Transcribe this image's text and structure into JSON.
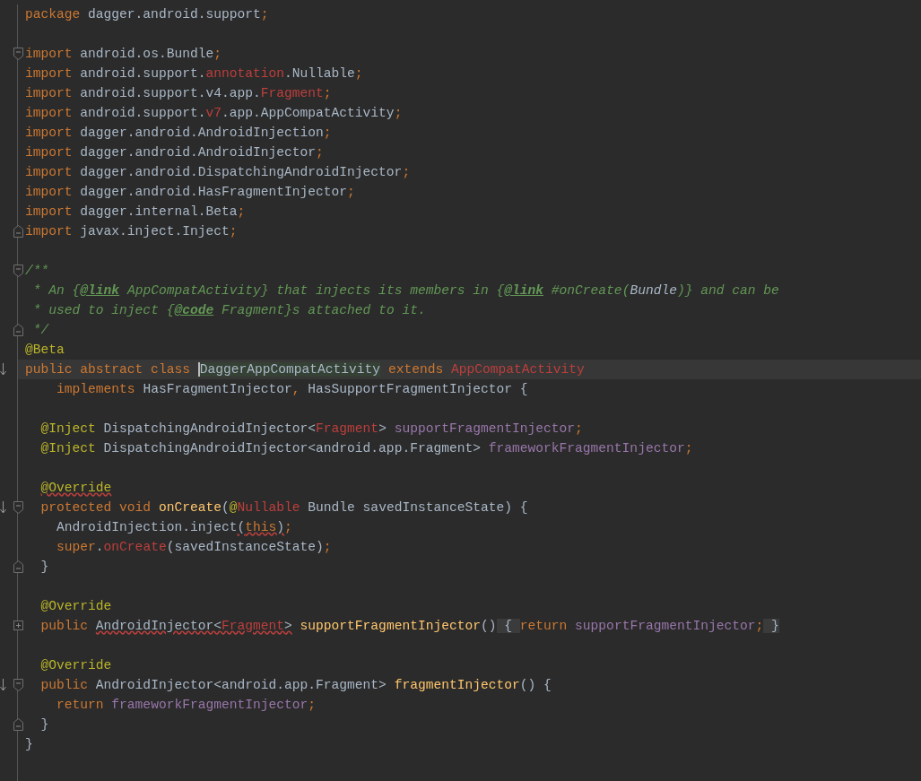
{
  "editor": {
    "lines": [
      {
        "kind": "code",
        "current": false,
        "tokens": [
          {
            "text": "package ",
            "kind": "kw"
          },
          {
            "text": "dagger.android.support",
            "kind": "plain"
          },
          {
            "text": ";",
            "kind": "kw"
          }
        ]
      },
      {
        "kind": "blank",
        "current": false
      },
      {
        "kind": "code",
        "current": false,
        "gutter": [
          {
            "kind": "fold_start"
          }
        ],
        "tokens": [
          {
            "text": "import ",
            "kind": "kw"
          },
          {
            "text": "android.os.Bundle",
            "kind": "plain"
          },
          {
            "text": ";",
            "kind": "kw"
          }
        ]
      },
      {
        "kind": "code",
        "current": false,
        "tokens": [
          {
            "text": "import ",
            "kind": "kw"
          },
          {
            "text": "android.support.",
            "kind": "plain"
          },
          {
            "text": "annotation",
            "kind": "err"
          },
          {
            "text": ".Nullable",
            "kind": "plain"
          },
          {
            "text": ";",
            "kind": "kw"
          }
        ]
      },
      {
        "kind": "code",
        "current": false,
        "tokens": [
          {
            "text": "import ",
            "kind": "kw"
          },
          {
            "text": "android.support.v4.app.",
            "kind": "plain"
          },
          {
            "text": "Fragment",
            "kind": "err"
          },
          {
            "text": ";",
            "kind": "kw"
          }
        ]
      },
      {
        "kind": "code",
        "current": false,
        "tokens": [
          {
            "text": "import ",
            "kind": "kw"
          },
          {
            "text": "android.support.",
            "kind": "plain"
          },
          {
            "text": "v7",
            "kind": "err"
          },
          {
            "text": ".app.AppCompatActivity",
            "kind": "plain"
          },
          {
            "text": ";",
            "kind": "kw"
          }
        ]
      },
      {
        "kind": "code",
        "current": false,
        "tokens": [
          {
            "text": "import ",
            "kind": "kw"
          },
          {
            "text": "dagger.android.AndroidInjection",
            "kind": "plain"
          },
          {
            "text": ";",
            "kind": "kw"
          }
        ]
      },
      {
        "kind": "code",
        "current": false,
        "tokens": [
          {
            "text": "import ",
            "kind": "kw"
          },
          {
            "text": "dagger.android.AndroidInjector",
            "kind": "plain"
          },
          {
            "text": ";",
            "kind": "kw"
          }
        ]
      },
      {
        "kind": "code",
        "current": false,
        "tokens": [
          {
            "text": "import ",
            "kind": "kw"
          },
          {
            "text": "dagger.android.DispatchingAndroidInjector",
            "kind": "plain"
          },
          {
            "text": ";",
            "kind": "kw"
          }
        ]
      },
      {
        "kind": "code",
        "current": false,
        "tokens": [
          {
            "text": "import ",
            "kind": "kw"
          },
          {
            "text": "dagger.android.HasFragmentInjector",
            "kind": "plain"
          },
          {
            "text": ";",
            "kind": "kw"
          }
        ]
      },
      {
        "kind": "code",
        "current": false,
        "tokens": [
          {
            "text": "import ",
            "kind": "kw"
          },
          {
            "text": "dagger.internal.Beta",
            "kind": "plain"
          },
          {
            "text": ";",
            "kind": "kw"
          }
        ]
      },
      {
        "kind": "code",
        "current": false,
        "gutter": [
          {
            "kind": "fold_end"
          }
        ],
        "tokens": [
          {
            "text": "import ",
            "kind": "kw"
          },
          {
            "text": "javax.inject.Inject",
            "kind": "plain"
          },
          {
            "text": ";",
            "kind": "kw"
          }
        ]
      },
      {
        "kind": "blank",
        "current": false
      },
      {
        "kind": "code",
        "current": false,
        "gutter": [
          {
            "kind": "fold_start"
          }
        ],
        "tokens": [
          {
            "text": "/**",
            "kind": "comment"
          }
        ]
      },
      {
        "kind": "code",
        "current": false,
        "tokens": [
          {
            "text": " * An {",
            "kind": "comment"
          },
          {
            "text": "@link",
            "kind": "doctag"
          },
          {
            "text": " AppCompatActivity} that injects its members in {",
            "kind": "comment"
          },
          {
            "text": "@link",
            "kind": "doctag"
          },
          {
            "text": " #onCreate(",
            "kind": "comment"
          },
          {
            "text": "Bundle",
            "kind": "docref"
          },
          {
            "text": ")} and can be",
            "kind": "comment"
          }
        ]
      },
      {
        "kind": "code",
        "current": false,
        "tokens": [
          {
            "text": " * used to inject {",
            "kind": "comment"
          },
          {
            "text": "@code",
            "kind": "doctag"
          },
          {
            "text": " Fragment}s attached to it.",
            "kind": "comment"
          }
        ]
      },
      {
        "kind": "code",
        "current": false,
        "gutter": [
          {
            "kind": "fold_end"
          }
        ],
        "tokens": [
          {
            "text": " */",
            "kind": "comment"
          }
        ]
      },
      {
        "kind": "code",
        "current": false,
        "tokens": [
          {
            "text": "@Beta",
            "kind": "ann"
          }
        ]
      },
      {
        "kind": "code",
        "current": true,
        "gutter": [
          {
            "kind": "override"
          }
        ],
        "tokens": [
          {
            "text": "public abstract class ",
            "kind": "kw"
          },
          {
            "text": "DaggerAppCompatActivity",
            "kind": "hl",
            "caret": true
          },
          {
            "text": " extends ",
            "kind": "kw"
          },
          {
            "text": "AppCompatActivity",
            "kind": "err"
          }
        ]
      },
      {
        "kind": "code",
        "current": false,
        "tokens": [
          {
            "text": "    implements ",
            "kind": "kw"
          },
          {
            "text": "HasFragmentInjector",
            "kind": "plain"
          },
          {
            "text": ", ",
            "kind": "kw"
          },
          {
            "text": "HasSupportFragmentInjector {",
            "kind": "plain"
          }
        ]
      },
      {
        "kind": "blank",
        "current": false
      },
      {
        "kind": "code",
        "current": false,
        "tokens": [
          {
            "text": "  @Inject",
            "kind": "ann"
          },
          {
            "text": " DispatchingAndroidInjector<",
            "kind": "plain"
          },
          {
            "text": "Fragment",
            "kind": "err"
          },
          {
            "text": "> ",
            "kind": "plain"
          },
          {
            "text": "supportFragmentInjector",
            "kind": "field"
          },
          {
            "text": ";",
            "kind": "kw"
          }
        ]
      },
      {
        "kind": "code",
        "current": false,
        "tokens": [
          {
            "text": "  @Inject",
            "kind": "ann"
          },
          {
            "text": " DispatchingAndroidInjector<android.app.Fragment> ",
            "kind": "plain"
          },
          {
            "text": "frameworkFragmentInjector",
            "kind": "field"
          },
          {
            "text": ";",
            "kind": "kw"
          }
        ]
      },
      {
        "kind": "blank",
        "current": false
      },
      {
        "kind": "code",
        "current": false,
        "tokens": [
          {
            "text": "  @Override",
            "kind": "ann",
            "warn": true
          }
        ]
      },
      {
        "kind": "code",
        "current": false,
        "gutter": [
          {
            "kind": "override"
          },
          {
            "kind": "fold_start"
          }
        ],
        "tokens": [
          {
            "text": "  protected void ",
            "kind": "kw"
          },
          {
            "text": "onCreate",
            "kind": "method"
          },
          {
            "text": "(",
            "kind": "plain"
          },
          {
            "text": "@",
            "kind": "ann"
          },
          {
            "text": "Nullable",
            "kind": "err"
          },
          {
            "text": " Bundle savedInstanceState) {",
            "kind": "plain"
          }
        ]
      },
      {
        "kind": "code",
        "current": false,
        "tokens": [
          {
            "text": "    AndroidInjection.inject",
            "kind": "plain"
          },
          {
            "text": "(",
            "kind": "plain",
            "warn": true
          },
          {
            "text": "this",
            "kind": "kw",
            "warn": true
          },
          {
            "text": ")",
            "kind": "plain",
            "warn": true
          },
          {
            "text": ";",
            "kind": "kw"
          }
        ]
      },
      {
        "kind": "code",
        "current": false,
        "tokens": [
          {
            "text": "    super",
            "kind": "kw"
          },
          {
            "text": ".",
            "kind": "plain"
          },
          {
            "text": "onCreate",
            "kind": "err"
          },
          {
            "text": "(savedInstanceState)",
            "kind": "plain"
          },
          {
            "text": ";",
            "kind": "kw"
          }
        ]
      },
      {
        "kind": "code",
        "current": false,
        "gutter": [
          {
            "kind": "fold_end"
          }
        ],
        "tokens": [
          {
            "text": "  }",
            "kind": "plain"
          }
        ]
      },
      {
        "kind": "blank",
        "current": false
      },
      {
        "kind": "code",
        "current": false,
        "tokens": [
          {
            "text": "  @Override",
            "kind": "ann"
          }
        ]
      },
      {
        "kind": "code",
        "current": false,
        "gutter": [
          {
            "kind": "fold_collapsed"
          }
        ],
        "tokens": [
          {
            "text": "  public ",
            "kind": "kw"
          },
          {
            "text": "AndroidInjector<",
            "kind": "plain",
            "warn": true
          },
          {
            "text": "Fragment",
            "kind": "err",
            "warn": true
          },
          {
            "text": ">",
            "kind": "plain",
            "warn": true
          },
          {
            "text": " supportFragmentInjector",
            "kind": "method"
          },
          {
            "text": "()",
            "kind": "plain"
          },
          {
            "text": " { ",
            "kind": "folded"
          },
          {
            "text": "return ",
            "kind": "kw"
          },
          {
            "text": "supportFragmentInjector",
            "kind": "field"
          },
          {
            "text": ";",
            "kind": "kw"
          },
          {
            "text": " }",
            "kind": "folded"
          }
        ]
      },
      {
        "kind": "blank",
        "current": false
      },
      {
        "kind": "code",
        "current": false,
        "tokens": [
          {
            "text": "  @Override",
            "kind": "ann"
          }
        ]
      },
      {
        "kind": "code",
        "current": false,
        "gutter": [
          {
            "kind": "override"
          },
          {
            "kind": "fold_start"
          }
        ],
        "tokens": [
          {
            "text": "  public ",
            "kind": "kw"
          },
          {
            "text": "AndroidInjector<android.app.Fragment> ",
            "kind": "plain"
          },
          {
            "text": "fragmentInjector",
            "kind": "method"
          },
          {
            "text": "() {",
            "kind": "plain"
          }
        ]
      },
      {
        "kind": "code",
        "current": false,
        "tokens": [
          {
            "text": "    return ",
            "kind": "kw"
          },
          {
            "text": "frameworkFragmentInjector",
            "kind": "field"
          },
          {
            "text": ";",
            "kind": "kw"
          }
        ]
      },
      {
        "kind": "code",
        "current": false,
        "gutter": [
          {
            "kind": "fold_end"
          }
        ],
        "tokens": [
          {
            "text": "  }",
            "kind": "plain"
          }
        ]
      },
      {
        "kind": "code",
        "current": false,
        "tokens": [
          {
            "text": "}",
            "kind": "plain"
          }
        ]
      }
    ]
  }
}
